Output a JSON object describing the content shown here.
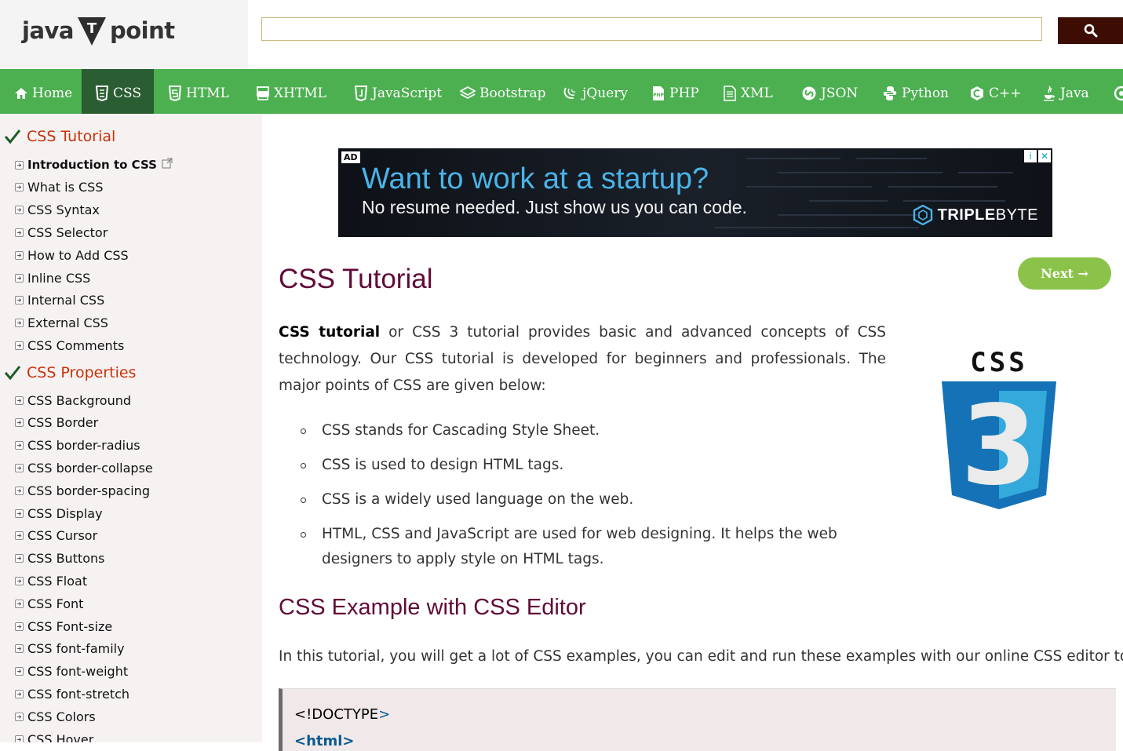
{
  "header": {
    "logo": {
      "part1": "java",
      "part2": "point",
      "mark": "T"
    },
    "search": {
      "placeholder": "",
      "value": "",
      "button_icon": "search-icon"
    }
  },
  "nav": {
    "items": [
      {
        "label": "Home",
        "icon": "home-icon",
        "active": false
      },
      {
        "label": "CSS",
        "icon": "css3-icon",
        "active": true
      },
      {
        "label": "HTML",
        "icon": "html5-icon",
        "active": false
      },
      {
        "label": "XHTML",
        "icon": "xhtml-icon",
        "active": false
      },
      {
        "label": "JavaScript",
        "icon": "javascript-icon",
        "active": false
      },
      {
        "label": "Bootstrap",
        "icon": "bootstrap-icon",
        "active": false
      },
      {
        "label": "jQuery",
        "icon": "jquery-icon",
        "active": false
      },
      {
        "label": "PHP",
        "icon": "php-icon",
        "active": false
      },
      {
        "label": "XML",
        "icon": "xml-icon",
        "active": false
      },
      {
        "label": "JSON",
        "icon": "json-icon",
        "active": false
      },
      {
        "label": "Python",
        "icon": "python-icon",
        "active": false
      },
      {
        "label": "C++",
        "icon": "cpp-icon",
        "active": false
      },
      {
        "label": "Java",
        "icon": "java-icon",
        "active": false
      }
    ]
  },
  "sidebar": {
    "section1": {
      "title": "CSS Tutorial"
    },
    "section1_items": [
      "Introduction to CSS",
      "What is CSS",
      "CSS Syntax",
      "CSS Selector",
      "How to Add CSS",
      "Inline CSS",
      "Internal CSS",
      "External CSS",
      "CSS Comments"
    ],
    "section2": {
      "title": "CSS Properties"
    },
    "section2_items": [
      "CSS Background",
      "CSS Border",
      "CSS border-radius",
      "CSS border-collapse",
      "CSS border-spacing",
      "CSS Display",
      "CSS Cursor",
      "CSS Buttons",
      "CSS Float",
      "CSS Font",
      "CSS Font-size",
      "CSS font-family",
      "CSS font-weight",
      "CSS font-stretch",
      "CSS Colors",
      "CSS Hover"
    ]
  },
  "ad": {
    "label": "AD",
    "headline": "Want to work at a startup?",
    "subline": "No resume needed. Just show us you can code.",
    "brand_bold": "TRIPLE",
    "brand_light": "BYTE",
    "info_icon": "i",
    "close_icon": "✕"
  },
  "content": {
    "title": "CSS Tutorial",
    "next_button": "Next →",
    "intro_bold": "CSS tutorial",
    "intro_rest": " or CSS 3 tutorial provides basic and advanced concepts of CSS technology. Our CSS tutorial is developed for beginners and professionals. The major points of CSS are given below:",
    "bullets": [
      "CSS stands for Cascading Style Sheet.",
      "CSS is used to design HTML tags.",
      "CSS is a widely used language on the web.",
      "HTML, CSS and JavaScript are used for web designing. It helps the web designers to apply style on HTML tags."
    ],
    "logo_caption": "CSS",
    "logo_number": "3",
    "section_heading": "CSS Example with CSS Editor",
    "section_text": "In this tutorial, you will get a lot of CSS examples, you can edit and run these examples with our online CSS editor tool.",
    "code": {
      "line1_text": "<!DOCTYPE",
      "line1_close": ">",
      "line2": "<html>"
    }
  },
  "colors": {
    "nav_bg": "#4caf50",
    "nav_active": "#2b5d32",
    "sidebar_bg": "#f7f2f2",
    "section_title": "#c83209",
    "heading": "#610b38",
    "next_btn": "#8bc34a",
    "search_btn": "#3d0c02"
  }
}
